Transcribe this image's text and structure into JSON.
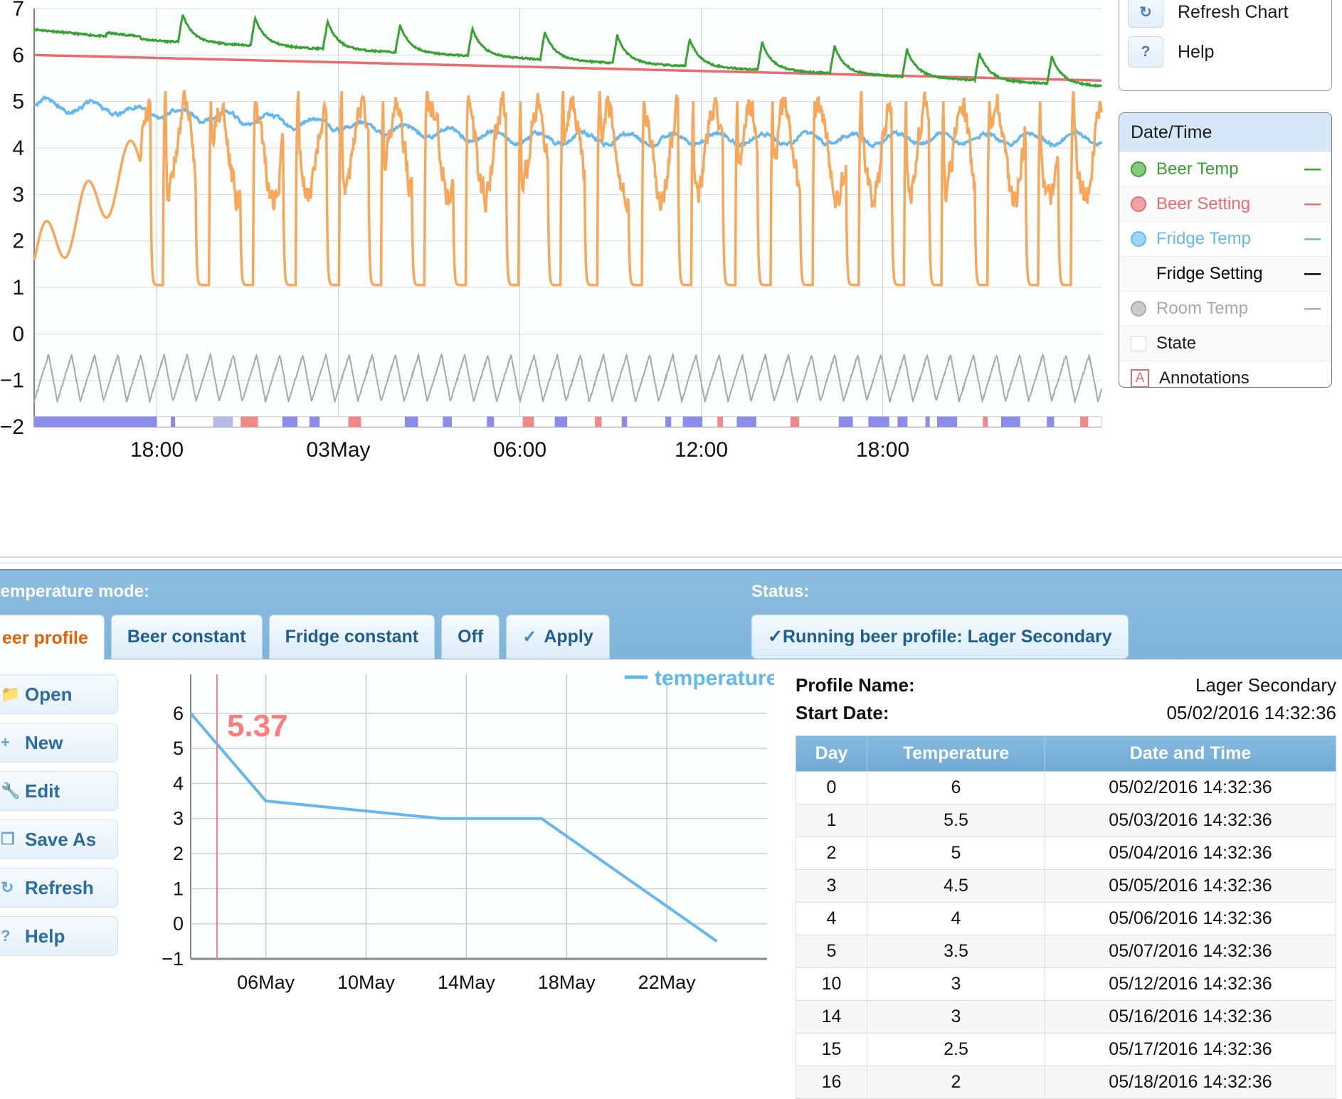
{
  "chart_tools": {
    "buttons": [
      {
        "name": "refresh-chart",
        "icon": "↻",
        "label": "Refresh Chart"
      },
      {
        "name": "help",
        "icon": "?",
        "label": "Help"
      }
    ]
  },
  "legend": {
    "header": "Date/Time",
    "items": [
      {
        "label": "Beer Temp",
        "color": "#35a32f",
        "marker": "dot",
        "dash": "––"
      },
      {
        "label": "Beer Setting",
        "color": "#ea6d6d",
        "marker": "dot",
        "dash": "––"
      },
      {
        "label": "Fridge Temp",
        "color": "#63b8f0",
        "marker": "dot",
        "dash": "––"
      },
      {
        "label": "Fridge Setting",
        "color": "#f7a košt",
        "marker": "dot",
        "dash": "––"
      },
      {
        "label": "Room Temp",
        "color": "#a8a8a8",
        "marker": "dot",
        "dash": "––"
      },
      {
        "label": "State",
        "color": "#ffffff",
        "marker": "square",
        "dash": ""
      },
      {
        "label": "Annotations",
        "color": "#e36b6b",
        "marker": "abox",
        "dash": ""
      }
    ]
  },
  "chart_data": [
    {
      "type": "line",
      "name": "fermentation-history",
      "title": "",
      "xlabel": "",
      "ylabel": "",
      "ylim": [
        -2,
        7
      ],
      "yticks": [
        -2,
        -1,
        0,
        1,
        2,
        3,
        4,
        5,
        6,
        7
      ],
      "xticks": [
        "18:00",
        "03May",
        "06:00",
        "12:00",
        "18:00"
      ],
      "grid": true,
      "legend_position": "right",
      "series": [
        {
          "name": "Beer Temp",
          "color": "#35a32f",
          "start": 6.55,
          "end": 5.45,
          "description": "sawtooth decaying from ~6.55 to ~5.45, periodic spikes up ~+0.5"
        },
        {
          "name": "Beer Setting",
          "color": "#ea6d6d",
          "start": 6.0,
          "end": 5.45,
          "description": "smooth straight decline 6.0 to 5.45"
        },
        {
          "name": "Fridge Temp",
          "color": "#63b8f0",
          "start": 5.0,
          "end": 4.2,
          "description": "noisy oscillation about 4.2-4.6"
        },
        {
          "name": "Fridge Setting",
          "color": "#f7a759",
          "start": 1.6,
          "end": 3.1,
          "description": "large square/spiky oscillations between ~1.0 and ~5.5"
        },
        {
          "name": "Room Temp",
          "color": "#a8a8a8",
          "start": -0.6,
          "end": -0.6,
          "description": "regular sawtooth between -1.4 and -0.45"
        }
      ],
      "state_bar": {
        "value": -2,
        "colors": [
          "#8b8bea",
          "#f08a8a"
        ]
      }
    },
    {
      "type": "line",
      "name": "beer-profile-preview",
      "title": "",
      "legend": [
        "temperature"
      ],
      "legend_color": "#63b8f0",
      "annotation": {
        "text": "5.37",
        "color": "#ff7c7c"
      },
      "ylim": [
        -1,
        6.3
      ],
      "yticks": [
        -1,
        0,
        1,
        2,
        3,
        4,
        5,
        6
      ],
      "xticks": [
        "06May",
        "10May",
        "14May",
        "18May",
        "22May"
      ],
      "grid": true,
      "x": [
        0,
        1,
        2,
        3,
        4,
        5,
        10,
        14,
        15,
        16,
        21
      ],
      "y": [
        6,
        5.5,
        5,
        4.5,
        4,
        3.5,
        3,
        3,
        2.5,
        2,
        -0.5
      ],
      "points": [
        {
          "day": 0,
          "temp": 6
        },
        {
          "day": 3,
          "temp": 3.5
        },
        {
          "day": 10,
          "temp": 3
        },
        {
          "day": 14,
          "temp": 3
        },
        {
          "day": 21,
          "temp": -0.5
        }
      ]
    }
  ],
  "mode_bar": {
    "mode_label": "t temperature mode:",
    "status_label": "Status:",
    "tabs": [
      {
        "name": "beer-profile",
        "label": "eer profile",
        "active": true
      },
      {
        "name": "beer-constant",
        "label": "Beer constant",
        "active": false
      },
      {
        "name": "fridge-constant",
        "label": "Fridge constant",
        "active": false
      },
      {
        "name": "off",
        "label": "Off",
        "active": false
      }
    ],
    "apply": {
      "label": "Apply",
      "check": "✓"
    },
    "status": {
      "check": "✓",
      "text": "Running beer profile: Lager Secondary"
    }
  },
  "side_buttons": [
    {
      "name": "open",
      "icon": "📁",
      "label": "Open"
    },
    {
      "name": "new",
      "icon": "+",
      "label": "New"
    },
    {
      "name": "edit",
      "icon": "🔧",
      "label": "Edit"
    },
    {
      "name": "save-as",
      "icon": "❐",
      "label": "Save As"
    },
    {
      "name": "refresh",
      "icon": "↻",
      "label": "Refresh"
    },
    {
      "name": "help",
      "icon": "?",
      "label": "Help"
    }
  ],
  "profile": {
    "name_label": "Profile Name:",
    "name_value": "Lager Secondary",
    "start_label": "Start Date:",
    "start_value": "05/02/2016 14:32:36",
    "columns": [
      "Day",
      "Temperature",
      "Date and Time"
    ],
    "rows": [
      [
        "0",
        "6",
        "05/02/2016 14:32:36"
      ],
      [
        "1",
        "5.5",
        "05/03/2016 14:32:36"
      ],
      [
        "2",
        "5",
        "05/04/2016 14:32:36"
      ],
      [
        "3",
        "4.5",
        "05/05/2016 14:32:36"
      ],
      [
        "4",
        "4",
        "05/06/2016 14:32:36"
      ],
      [
        "5",
        "3.5",
        "05/07/2016 14:32:36"
      ],
      [
        "10",
        "3",
        "05/12/2016 14:32:36"
      ],
      [
        "14",
        "3",
        "05/16/2016 14:32:36"
      ],
      [
        "15",
        "2.5",
        "05/17/2016 14:32:36"
      ],
      [
        "16",
        "2",
        "05/18/2016 14:32:36"
      ]
    ]
  },
  "colors": {
    "beer_temp": "#35a32f",
    "beer_setting": "#ea6d6d",
    "fridge_temp": "#63b8f0",
    "fridge_setting": "#f7a759",
    "room_temp": "#a8a8a8",
    "accent_blue": "#1f5f90",
    "active_tab": "#e2620a"
  }
}
